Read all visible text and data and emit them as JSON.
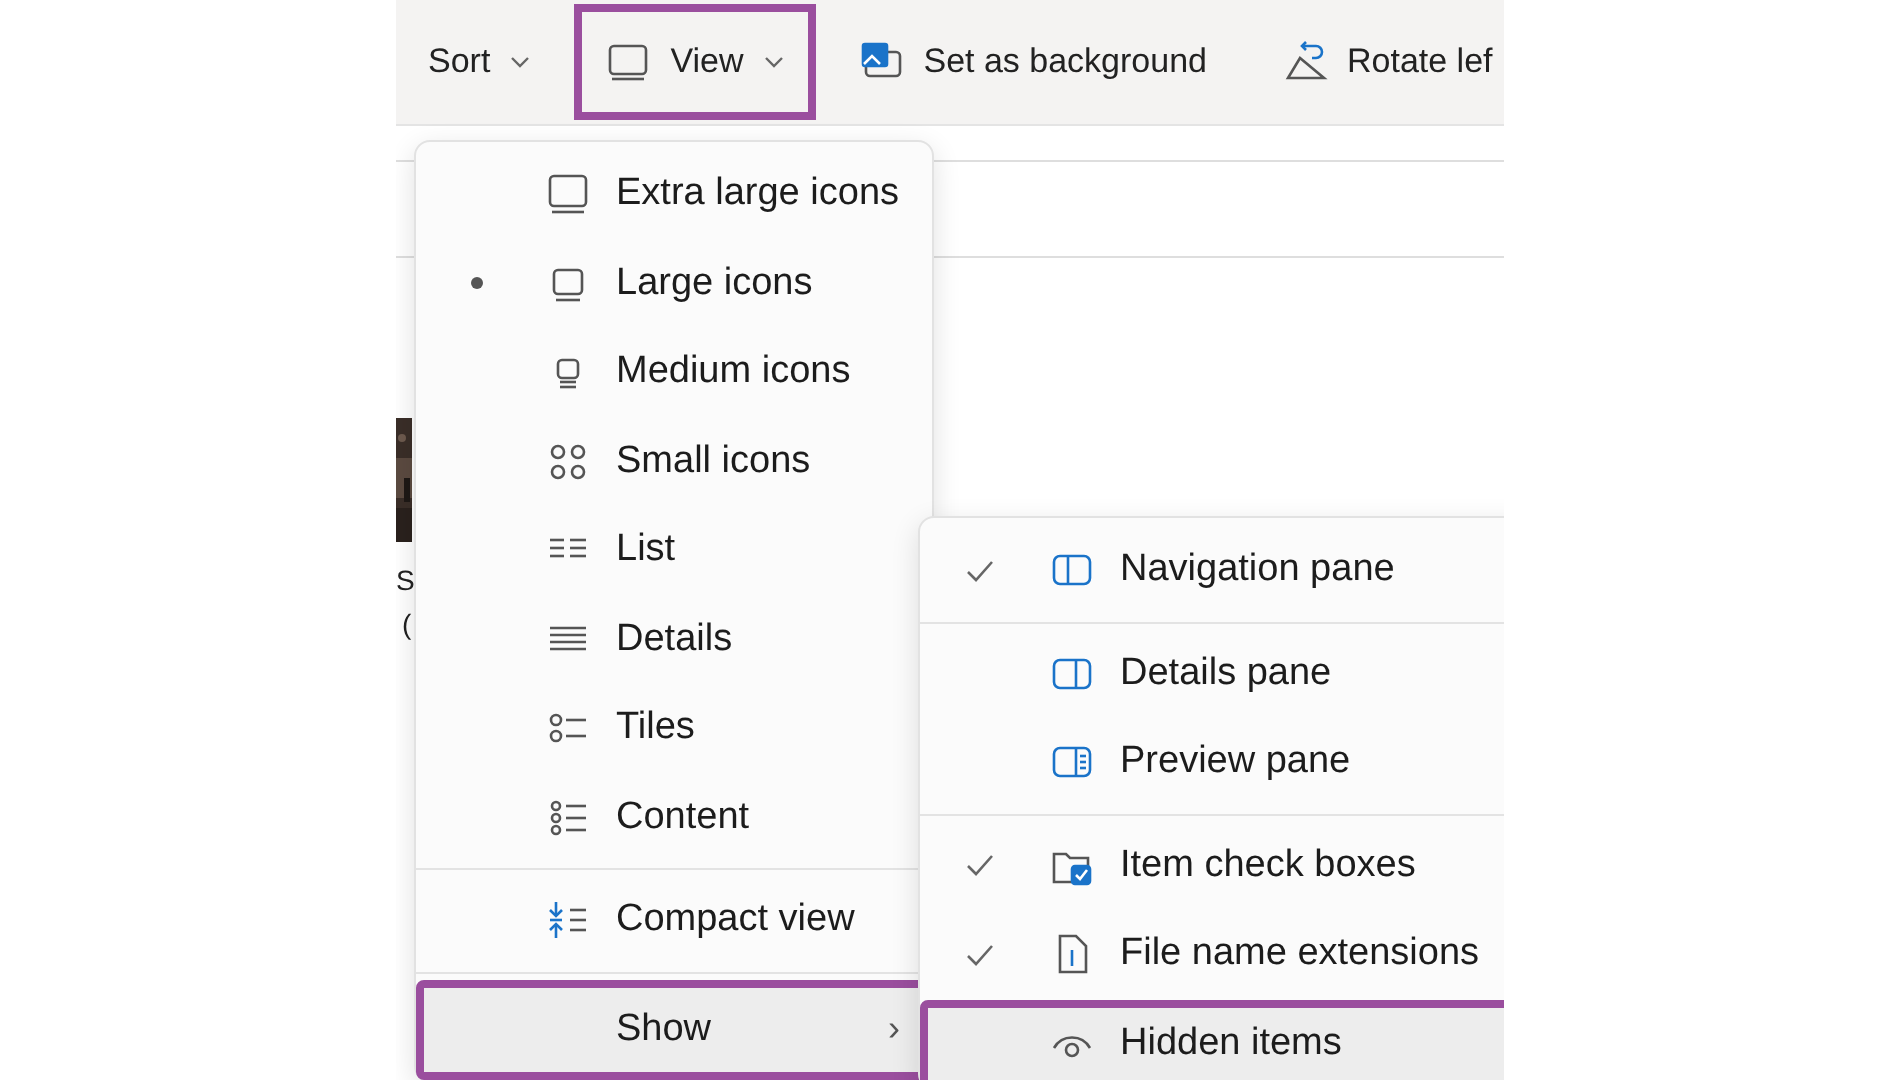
{
  "toolbar": {
    "items": [
      {
        "label": "Sort",
        "dropdown": true,
        "annotated": false
      },
      {
        "label": "View",
        "dropdown": true,
        "annotated": true
      },
      {
        "label": "Set as background",
        "dropdown": false,
        "annotated": false
      },
      {
        "label": "Rotate lef",
        "dropdown": false,
        "annotated": false
      }
    ]
  },
  "file_item": {
    "kind": "picture",
    "label_lines": [
      "S",
      "("
    ]
  },
  "view_menu": {
    "groups": [
      [
        {
          "label": "Extra large icons",
          "kind": "radio",
          "selected": false
        },
        {
          "label": "Large icons",
          "kind": "radio",
          "selected": true
        },
        {
          "label": "Medium icons",
          "kind": "radio",
          "selected": false
        },
        {
          "label": "Small icons",
          "kind": "radio",
          "selected": false
        },
        {
          "label": "List",
          "kind": "radio",
          "selected": false
        },
        {
          "label": "Details",
          "kind": "radio",
          "selected": false
        },
        {
          "label": "Tiles",
          "kind": "radio",
          "selected": false
        },
        {
          "label": "Content",
          "kind": "radio",
          "selected": false
        }
      ],
      [
        {
          "label": "Compact view",
          "kind": "toggle",
          "checked": false
        }
      ],
      [
        {
          "label": "Show",
          "kind": "submenu",
          "chevron": "›",
          "annotated": true
        }
      ]
    ]
  },
  "show_menu": {
    "groups": [
      [
        {
          "label": "Navigation pane",
          "checked": true,
          "annotated": false
        }
      ],
      [
        {
          "label": "Details pane",
          "checked": false,
          "annotated": false
        },
        {
          "label": "Preview pane",
          "checked": false,
          "annotated": false
        }
      ],
      [
        {
          "label": "Item check boxes",
          "checked": true,
          "annotated": false
        },
        {
          "label": "File name extensions",
          "checked": true,
          "annotated": false
        },
        {
          "label": "Hidden items",
          "checked": false,
          "annotated": true
        }
      ]
    ]
  }
}
